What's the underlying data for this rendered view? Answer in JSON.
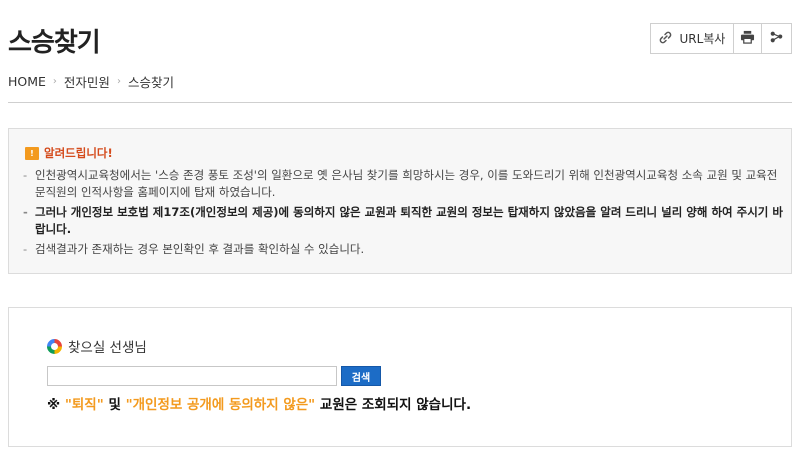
{
  "header": {
    "title": "스승찾기",
    "toolbar": {
      "url_copy_label": "URL복사",
      "print_icon": "print-icon",
      "share_icon": "share-icon",
      "link_icon": "link-icon"
    }
  },
  "breadcrumb": {
    "items": [
      "HOME",
      "전자민원",
      "스승찾기"
    ],
    "separator": "›"
  },
  "notice": {
    "badge": "!",
    "heading": "알려드립니다!",
    "items": [
      "인천광역시교육청에서는 '스승 존경 풍토 조성'의 일환으로 옛 은사님 찾기를 희망하시는 경우, 이를 도와드리기 위해 인천광역시교육청 소속 교원 및 교육전문직원의 인적사항을 홈페이지에 탑재 하였습니다.",
      "그러나 개인정보 보호법 제17조(개인정보의 제공)에 동의하지 않은 교원과 퇴직한 교원의 정보는 탑재하지 않았음을 알려 드리니 널리 양해 하여 주시기 바랍니다.",
      "검색결과가 존재하는 경우 본인확인 후 결과를 확인하실 수 있습니다."
    ],
    "accent_color": "#f39a1e"
  },
  "search": {
    "label": "찾으실 선생님",
    "input_value": "",
    "button_label": "검색",
    "note": {
      "prefix": "※ ",
      "hl1": "\"퇴직\"",
      "mid": " 및 ",
      "hl2": "\"개인정보 공개에 동의하지 않은\"",
      "suffix": " 교원은 조회되지 않습니다."
    },
    "button_color": "#1c6cc6",
    "highlight_color": "#f39a1e"
  }
}
